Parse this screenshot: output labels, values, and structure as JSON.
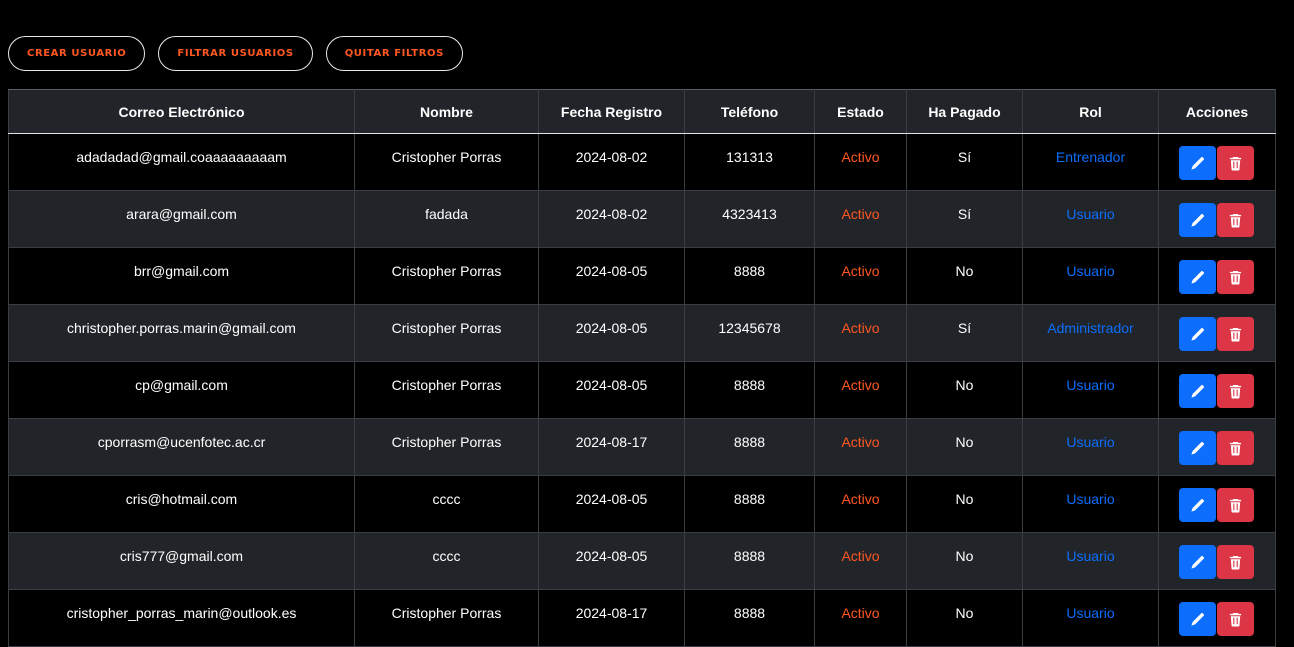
{
  "toolbar": {
    "create_label": "CREAR USUARIO",
    "filter_label": "FILTRAR USUARIOS",
    "clear_label": "QUITAR FILTROS"
  },
  "table": {
    "headers": [
      "Correo Electrónico",
      "Nombre",
      "Fecha Registro",
      "Teléfono",
      "Estado",
      "Ha Pagado",
      "Rol",
      "Acciones"
    ],
    "rows": [
      {
        "email": "adadadad@gmail.coaaaaaaaaam",
        "nombre": "Cristopher Porras",
        "fecha": "2024-08-02",
        "telefono": "131313",
        "estado": "Activo",
        "pagado": "Sí",
        "rol": "Entrenador"
      },
      {
        "email": "arara@gmail.com",
        "nombre": "fadada",
        "fecha": "2024-08-02",
        "telefono": "4323413",
        "estado": "Activo",
        "pagado": "Sí",
        "rol": "Usuario"
      },
      {
        "email": "brr@gmail.com",
        "nombre": "Cristopher Porras",
        "fecha": "2024-08-05",
        "telefono": "8888",
        "estado": "Activo",
        "pagado": "No",
        "rol": "Usuario"
      },
      {
        "email": "christopher.porras.marin@gmail.com",
        "nombre": "Cristopher Porras",
        "fecha": "2024-08-05",
        "telefono": "12345678",
        "estado": "Activo",
        "pagado": "Sí",
        "rol": "Administrador"
      },
      {
        "email": "cp@gmail.com",
        "nombre": "Cristopher Porras",
        "fecha": "2024-08-05",
        "telefono": "8888",
        "estado": "Activo",
        "pagado": "No",
        "rol": "Usuario"
      },
      {
        "email": "cporrasm@ucenfotec.ac.cr",
        "nombre": "Cristopher Porras",
        "fecha": "2024-08-17",
        "telefono": "8888",
        "estado": "Activo",
        "pagado": "No",
        "rol": "Usuario"
      },
      {
        "email": "cris@hotmail.com",
        "nombre": "cccc",
        "fecha": "2024-08-05",
        "telefono": "8888",
        "estado": "Activo",
        "pagado": "No",
        "rol": "Usuario"
      },
      {
        "email": "cris777@gmail.com",
        "nombre": "cccc",
        "fecha": "2024-08-05",
        "telefono": "8888",
        "estado": "Activo",
        "pagado": "No",
        "rol": "Usuario"
      },
      {
        "email": "cristopher_porras_marin@outlook.es",
        "nombre": "Cristopher Porras",
        "fecha": "2024-08-17",
        "telefono": "8888",
        "estado": "Activo",
        "pagado": "No",
        "rol": "Usuario"
      }
    ]
  },
  "icons": {
    "edit": "pencil-icon",
    "delete": "trash-icon"
  },
  "colors": {
    "accent": "#ff5722",
    "role_link": "#0d6efd",
    "edit_button": "#0d6efd",
    "delete_button": "#dc3545"
  }
}
